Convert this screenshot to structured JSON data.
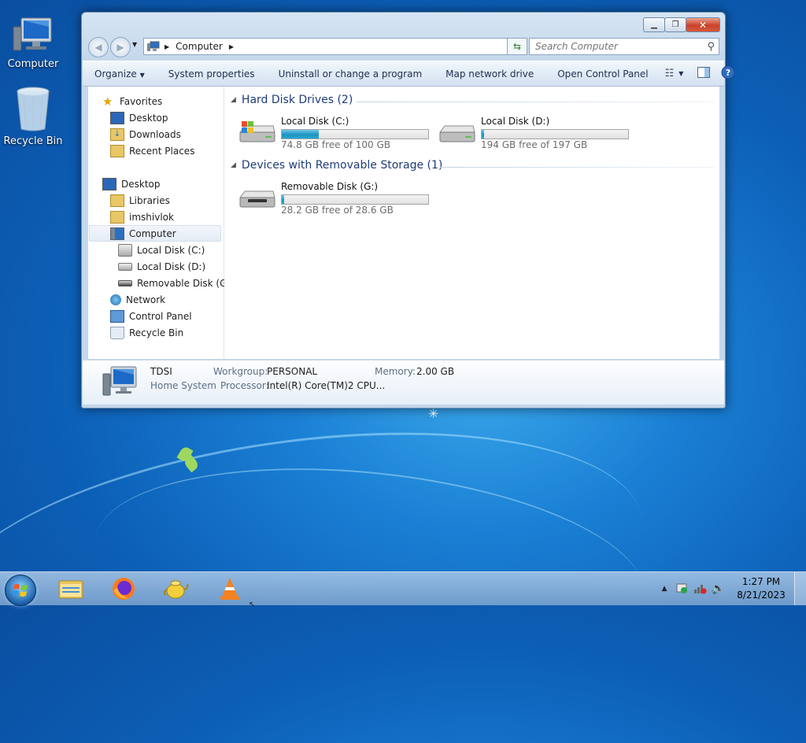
{
  "desktop": {
    "icons": [
      {
        "label": "Computer",
        "icon": "computer-icon"
      },
      {
        "label": "Recycle Bin",
        "icon": "recycle-bin-icon"
      }
    ]
  },
  "window": {
    "address": {
      "path": "Computer"
    },
    "search": {
      "placeholder": "Search Computer"
    },
    "toolbar": {
      "organize": "Organize",
      "system_properties": "System properties",
      "uninstall": "Uninstall or change a program",
      "map_drive": "Map network drive",
      "control_panel": "Open Control Panel"
    },
    "nav": {
      "favorites": "Favorites",
      "desktop_fav": "Desktop",
      "downloads": "Downloads",
      "recent": "Recent Places",
      "desktop": "Desktop",
      "libraries": "Libraries",
      "user": "imshivlok",
      "computer": "Computer",
      "drive_c": "Local Disk (C:)",
      "drive_d": "Local Disk (D:)",
      "drive_g": "Removable Disk (G:)",
      "network": "Network",
      "control_panel": "Control Panel",
      "recycle_bin": "Recycle Bin"
    },
    "groups": {
      "hdd": "Hard Disk Drives (2)",
      "removable": "Devices with Removable Storage (1)"
    },
    "drives": {
      "c": {
        "name": "Local Disk (C:)",
        "free": "74.8 GB free of 100 GB",
        "used_fraction": 0.252
      },
      "d": {
        "name": "Local Disk (D:)",
        "free": "194 GB free of 197 GB",
        "used_fraction": 0.015
      },
      "g": {
        "name": "Removable Disk (G:)",
        "free": "28.2 GB free of 28.6 GB",
        "used_fraction": 0.014
      }
    },
    "details": {
      "computer_name": "TDSI",
      "edition": "Home System",
      "workgroup_label": "Workgroup:",
      "workgroup": "PERSONAL",
      "memory_label": "Memory:",
      "memory": "2.00 GB",
      "processor_label": "Processor:",
      "processor": "Intel(R) Core(TM)2 CPU..."
    }
  },
  "taskbar": {
    "apps": [
      "file-explorer-icon",
      "firefox-icon",
      "teapot-app-icon",
      "vlc-icon"
    ],
    "clock": {
      "time": "1:27 PM",
      "date": "8/21/2023"
    }
  },
  "colors": {
    "accent": "#1e3c78",
    "bar_fill": "#1d93c2",
    "close_button": "#c9422a"
  }
}
